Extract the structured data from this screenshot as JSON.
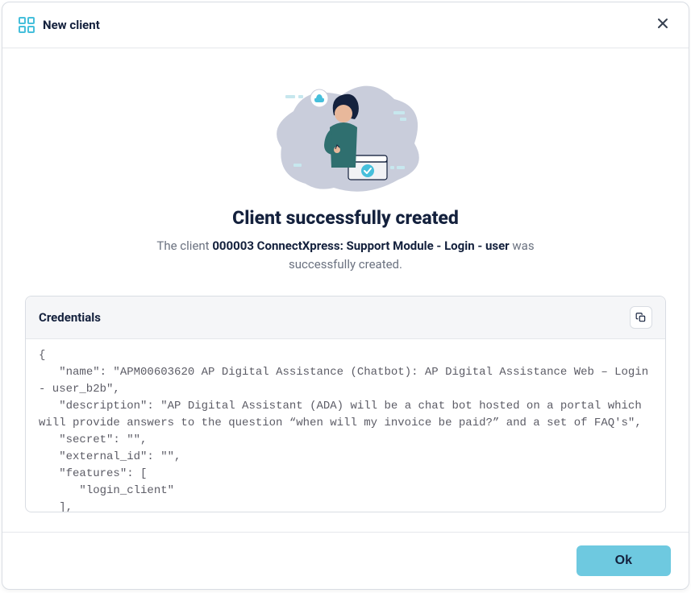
{
  "header": {
    "title": "New client"
  },
  "success": {
    "title": "Client successfully created",
    "desc_prefix": "The client ",
    "client_name": "000003 ConnectXpress: Support Module - Login - user",
    "desc_suffix": " was successfully created."
  },
  "credentials": {
    "title": "Credentials",
    "body": "{\n   \"name\": \"APM00603620 AP Digital Assistance (Chatbot): AP Digital Assistance Web – Login - user_b2b\",\n   \"description\": \"AP Digital Assistant (ADA) will be a chat bot hosted on a portal which will provide answers to the question “when will my invoice be paid?” and a set of FAQ's\",\n   \"secret\": \"\",\n   \"external_id\": \"\",\n   \"features\": [\n      \"login_client\"\n   ],\n   \"integration_type\": \"journey\","
  },
  "footer": {
    "ok": "Ok"
  }
}
